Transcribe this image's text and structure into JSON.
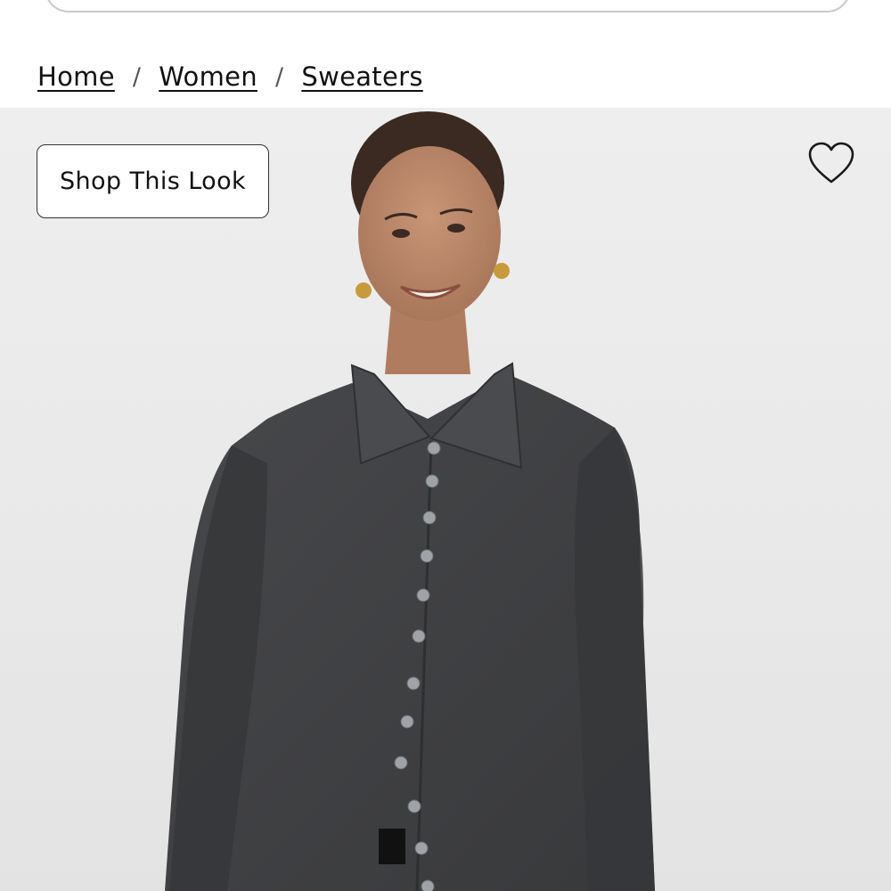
{
  "breadcrumb": {
    "items": [
      "Home",
      "Women",
      "Sweaters"
    ],
    "separator": "/"
  },
  "hero": {
    "shop_look_label": "Shop This Look",
    "favorite_icon": "heart-outline-icon",
    "product_image": "model-wearing-charcoal-knit-cardigan"
  },
  "colors": {
    "background": "#ffffff",
    "hero_background": "#ececec",
    "sweater": "#3f4042",
    "text": "#111111"
  }
}
